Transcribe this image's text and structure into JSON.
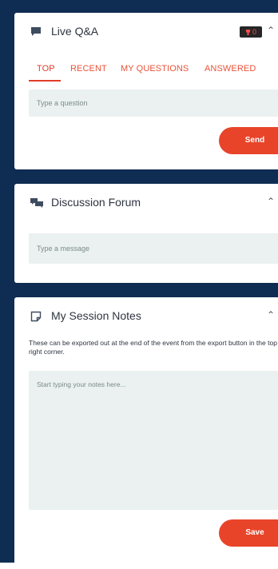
{
  "colors": {
    "background": "#0f2d52",
    "card": "#ffffff",
    "accent": "#e8442a",
    "input_bg": "#eaf1f0"
  },
  "qa": {
    "title": "Live Q&A",
    "icon": "chat-bubble-icon",
    "badge_count": "0",
    "tabs": [
      "TOP",
      "RECENT",
      "MY QUESTIONS",
      "ANSWERED"
    ],
    "active_tab": "TOP",
    "input_placeholder": "Type a question",
    "send_label": "Send"
  },
  "forum": {
    "title": "Discussion Forum",
    "icon": "discussion-icon",
    "input_placeholder": "Type a message"
  },
  "notes": {
    "title": "My Session Notes",
    "icon": "note-icon",
    "description": "These can be exported out at the end of the event from the export button in the top right corner.",
    "textarea_placeholder": "Start typing your notes here...",
    "save_label": "Save"
  }
}
